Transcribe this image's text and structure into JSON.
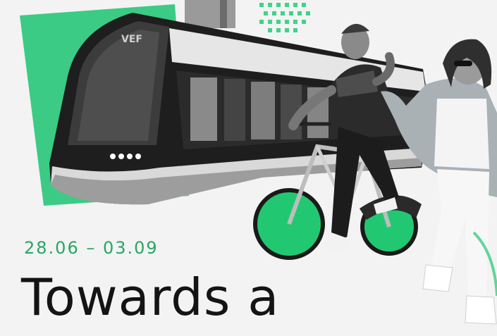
{
  "poster": {
    "dates": "28.06 – 03.09",
    "headline": "Towards a",
    "tram_logo": "VEF"
  },
  "colors": {
    "accent_green": "#22c871",
    "background": "#f3f3f3",
    "text_dark": "#141414",
    "date_green": "#2aa564"
  }
}
